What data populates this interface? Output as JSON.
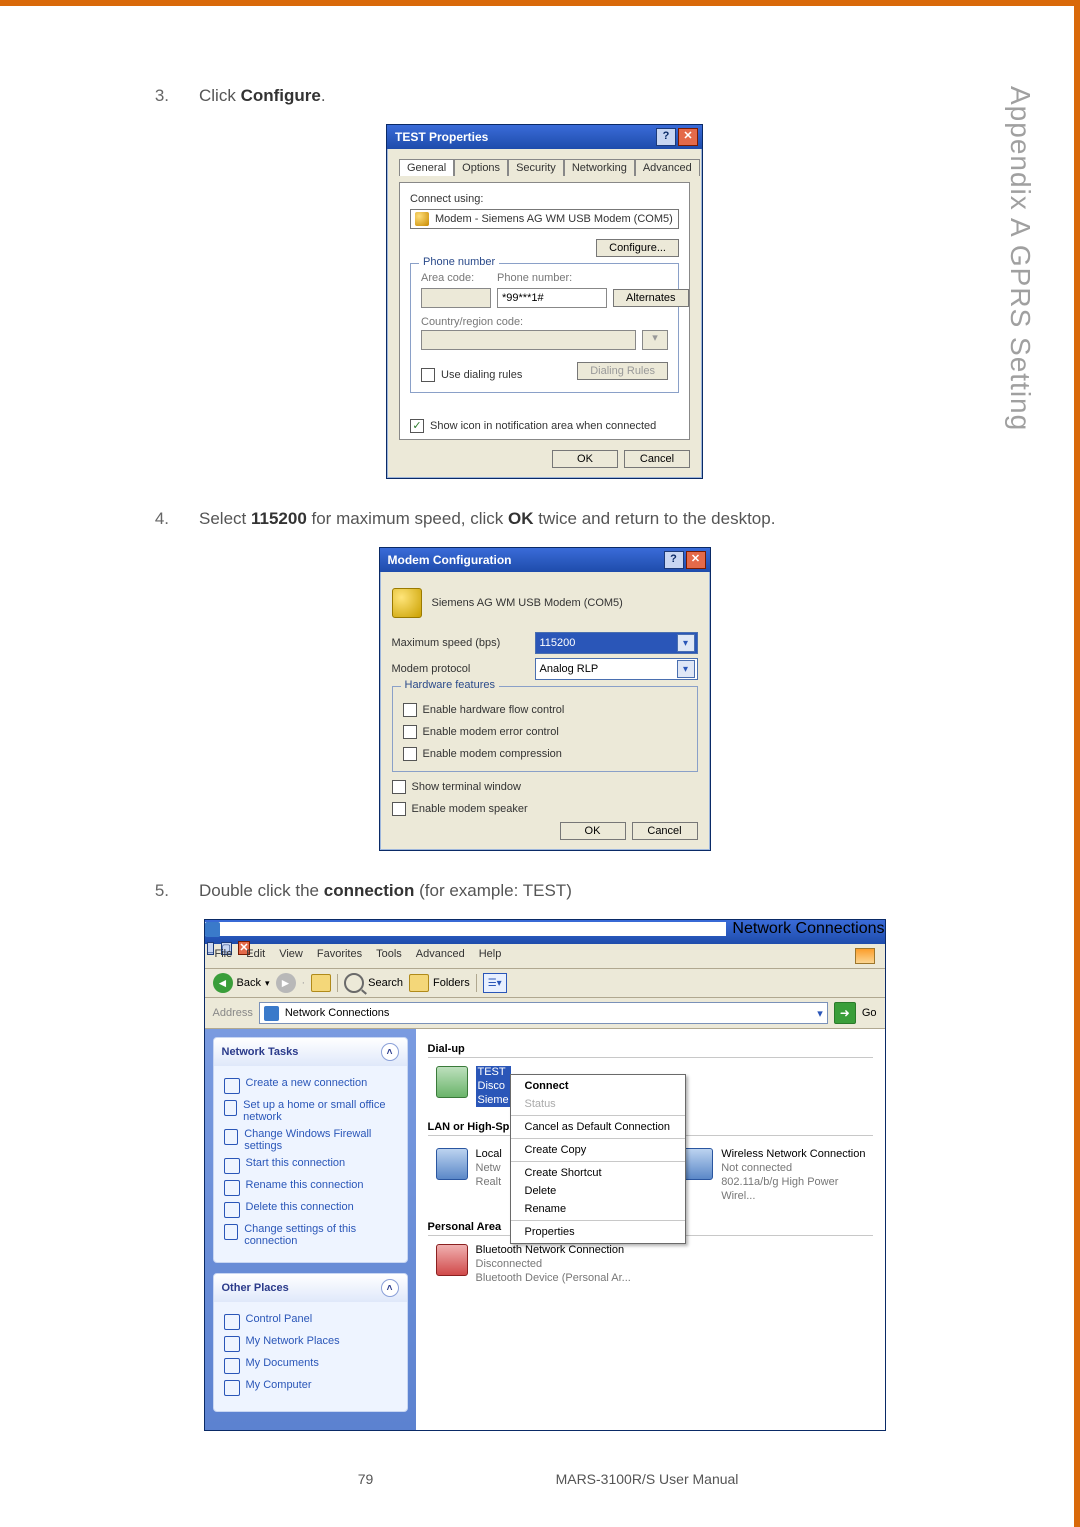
{
  "side_heading": "Appendix A  GPRS Setting",
  "steps": {
    "s3_num": "3.",
    "s3_prefix": "Click ",
    "s3_bold": "Configure",
    "s3_suffix": ".",
    "s4_num": "4.",
    "s4_a": "Select ",
    "s4_b": "115200",
    "s4_c": " for maximum speed, click ",
    "s4_d": "OK",
    "s4_e": " twice and return to the desktop.",
    "s5_num": "5.",
    "s5_a": "Double click the ",
    "s5_b": "connection",
    "s5_c": " (for example: TEST)"
  },
  "dlg1": {
    "title": "TEST Properties",
    "tabs": [
      "General",
      "Options",
      "Security",
      "Networking",
      "Advanced"
    ],
    "connect_using_label": "Connect using:",
    "modem": "Modem - Siemens AG WM USB Modem (COM5)",
    "configure_btn": "Configure...",
    "phone_legend": "Phone number",
    "area_code_label": "Area code:",
    "phone_number_label": "Phone number:",
    "phone_number_value": "*99***1#",
    "alternates_btn": "Alternates",
    "country_label": "Country/region code:",
    "use_dialing_rules": "Use dialing rules",
    "dialing_rules_btn": "Dialing Rules",
    "show_icon": "Show icon in notification area when connected",
    "ok": "OK",
    "cancel": "Cancel"
  },
  "dlg2": {
    "title": "Modem Configuration",
    "device": "Siemens AG WM USB Modem (COM5)",
    "max_speed_label": "Maximum speed (bps)",
    "max_speed_value": "115200",
    "protocol_label": "Modem protocol",
    "protocol_value": "Analog RLP",
    "hw_legend": "Hardware features",
    "chk_flow": "Enable hardware flow control",
    "chk_err": "Enable modem error control",
    "chk_comp": "Enable modem compression",
    "chk_term": "Show terminal window",
    "chk_spk": "Enable modem speaker",
    "ok": "OK",
    "cancel": "Cancel"
  },
  "win": {
    "title": "Network Connections",
    "menu": [
      "File",
      "Edit",
      "View",
      "Favorites",
      "Tools",
      "Advanced",
      "Help"
    ],
    "tb_back": "Back",
    "tb_search": "Search",
    "tb_folders": "Folders",
    "addr_label": "Address",
    "addr_value": "Network Connections",
    "go": "Go",
    "tasks_head": "Network Tasks",
    "tasks": [
      "Create a new connection",
      "Set up a home or small office network",
      "Change Windows Firewall settings",
      "Start this connection",
      "Rename this connection",
      "Delete this connection",
      "Change settings of this connection"
    ],
    "other_head": "Other Places",
    "other": [
      "Control Panel",
      "My Network Places",
      "My Documents",
      "My Computer"
    ],
    "grp_dialup": "Dial-up",
    "grp_lan": "LAN or High-Sp",
    "grp_pan": "Personal Area",
    "conn_test": "TEST",
    "conn_test_sub1": "Disco",
    "conn_test_sub2": "Sieme",
    "conn_lan_l1": "Local",
    "conn_lan_l2": "Netw",
    "conn_lan_l3": "Realt",
    "conn_wifi_name": "Wireless Network Connection",
    "conn_wifi_sub1": "Not connected",
    "conn_wifi_sub2": "802.11a/b/g High Power Wirel...",
    "conn_bt_name": "Bluetooth Network Connection",
    "conn_bt_sub1": "Disconnected",
    "conn_bt_sub2": "Bluetooth Device (Personal Ar...",
    "ctx": {
      "connect": "Connect",
      "status": "Status",
      "cancel_default": "Cancel as Default Connection",
      "create_copy": "Create Copy",
      "create_shortcut": "Create Shortcut",
      "delete": "Delete",
      "rename": "Rename",
      "properties": "Properties"
    }
  },
  "footer": {
    "page": "79",
    "manual": "MARS-3100R/S User Manual"
  }
}
